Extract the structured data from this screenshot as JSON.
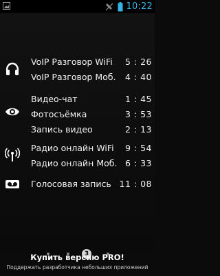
{
  "status_bar": {
    "time": "10:22"
  },
  "groups": [
    {
      "icon": "headset-icon",
      "items": [
        {
          "label": "VoIP Разговор WiFi",
          "value": "5 : 26"
        },
        {
          "label": "VoIP Разговор Моб.",
          "value": "4 : 40"
        }
      ]
    },
    {
      "icon": "eye-icon",
      "items": [
        {
          "label": "Видео-чат",
          "value": "1 : 45"
        },
        {
          "label": "Фотосъёмка",
          "value": "3 : 53"
        },
        {
          "label": "Запись видео",
          "value": "2 : 13"
        }
      ]
    },
    {
      "icon": "radio-antenna-icon",
      "items": [
        {
          "label": "Радио онлайн WiFi",
          "value": "9 : 54"
        },
        {
          "label": "Радио онлайн Моб.",
          "value": "6 : 33"
        }
      ]
    },
    {
      "icon": "voicemail-icon",
      "items": [
        {
          "label": "Голосовая запись",
          "value": "11 : 08"
        }
      ]
    }
  ],
  "pager": {
    "current_page": "3",
    "total_pages": 4
  },
  "promo": {
    "title": "Купить версию PRO!",
    "subtitle": "Поддержать разработчика небольших приложений"
  },
  "colors": {
    "accent": "#33b5e5",
    "background": "#0b0b0b",
    "text": "#ffffff"
  }
}
